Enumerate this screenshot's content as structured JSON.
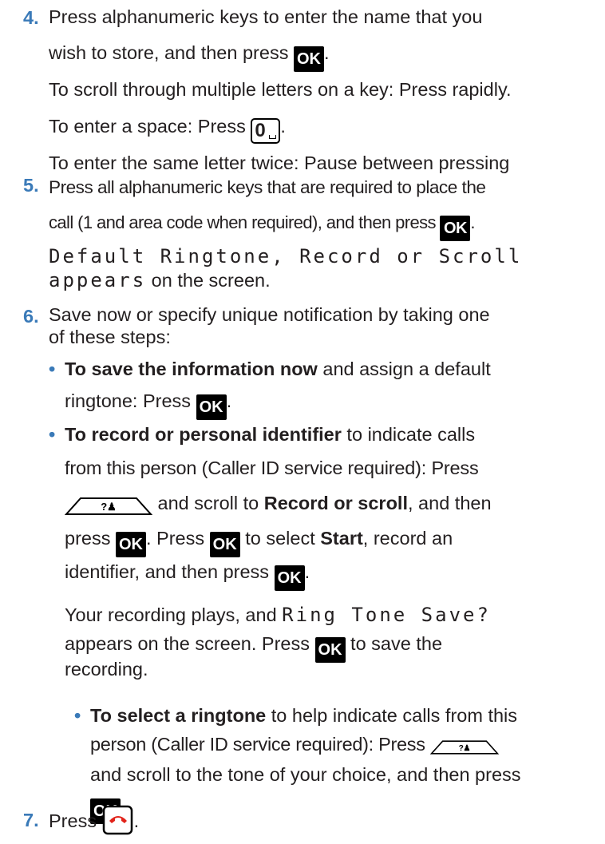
{
  "steps": [
    {
      "number": "4.",
      "line1": "Press alphanumeric keys to enter the name that you",
      "line2_pre": "wish to store, and then press",
      "line2_post": ".",
      "line3": "To scroll through multiple letters on a key: Press rapidly.",
      "line4_pre": "To enter a space: Press",
      "line4_post": ".",
      "line5": "To enter the same letter twice: Pause between pressing"
    },
    {
      "number": "5.",
      "line1": "Press all alphanumeric keys that are required to place the",
      "line2_pre": "call (1 and area code when required), and then press",
      "line2_post": ".",
      "lcd1": "Default Ringtone, Record or Scroll",
      "lcd2": "appears",
      "line4_post": " on the screen."
    },
    {
      "number": "6.",
      "line1": "Save now or specify unique notification by taking one",
      "line2": "of these steps:"
    },
    {
      "number": "7.",
      "text_pre": "Press",
      "text_post": "."
    }
  ],
  "bullets": [
    {
      "bold": "To save the information now",
      "l1_rest": " and assign a default",
      "l2_pre": "ringtone: Press",
      "l2_post": "."
    },
    {
      "bold": "To record or personal identifier",
      "l1_rest": " to indicate calls",
      "l2": "from this person (Caller ID service required): Press",
      "l3_mid": " and scroll to ",
      "l3_bold": "Record or scroll",
      "l3_post": ", and then",
      "l4_pre": "press",
      "l4_mid": ". Press",
      "l4_mid2": " to select ",
      "l4_bold": "Start",
      "l4_post": ", record an",
      "l5_pre": "identifier, and then press",
      "l5_post": ".",
      "p1_pre": "Your recording plays, and ",
      "p1_lcd": "Ring Tone Save?",
      "p2_pre": "appears on the screen. Press",
      "p2_post": " to save the",
      "p3": "recording."
    },
    {
      "bold": "To select a ringtone",
      "l1_rest": " to help indicate calls from this",
      "l2_pre": "person (Caller ID service required): Press",
      "l3": "and scroll to the tone of your choice, and then press",
      "l4_post": "."
    }
  ],
  "keys": {
    "ok_label": "OK",
    "zero_label": "0",
    "softkey_label": "?♟"
  },
  "colors": {
    "step_number": "#3a7ab8",
    "text": "#231f20",
    "ok_bg": "#000000",
    "end_call": "#e2231a"
  }
}
